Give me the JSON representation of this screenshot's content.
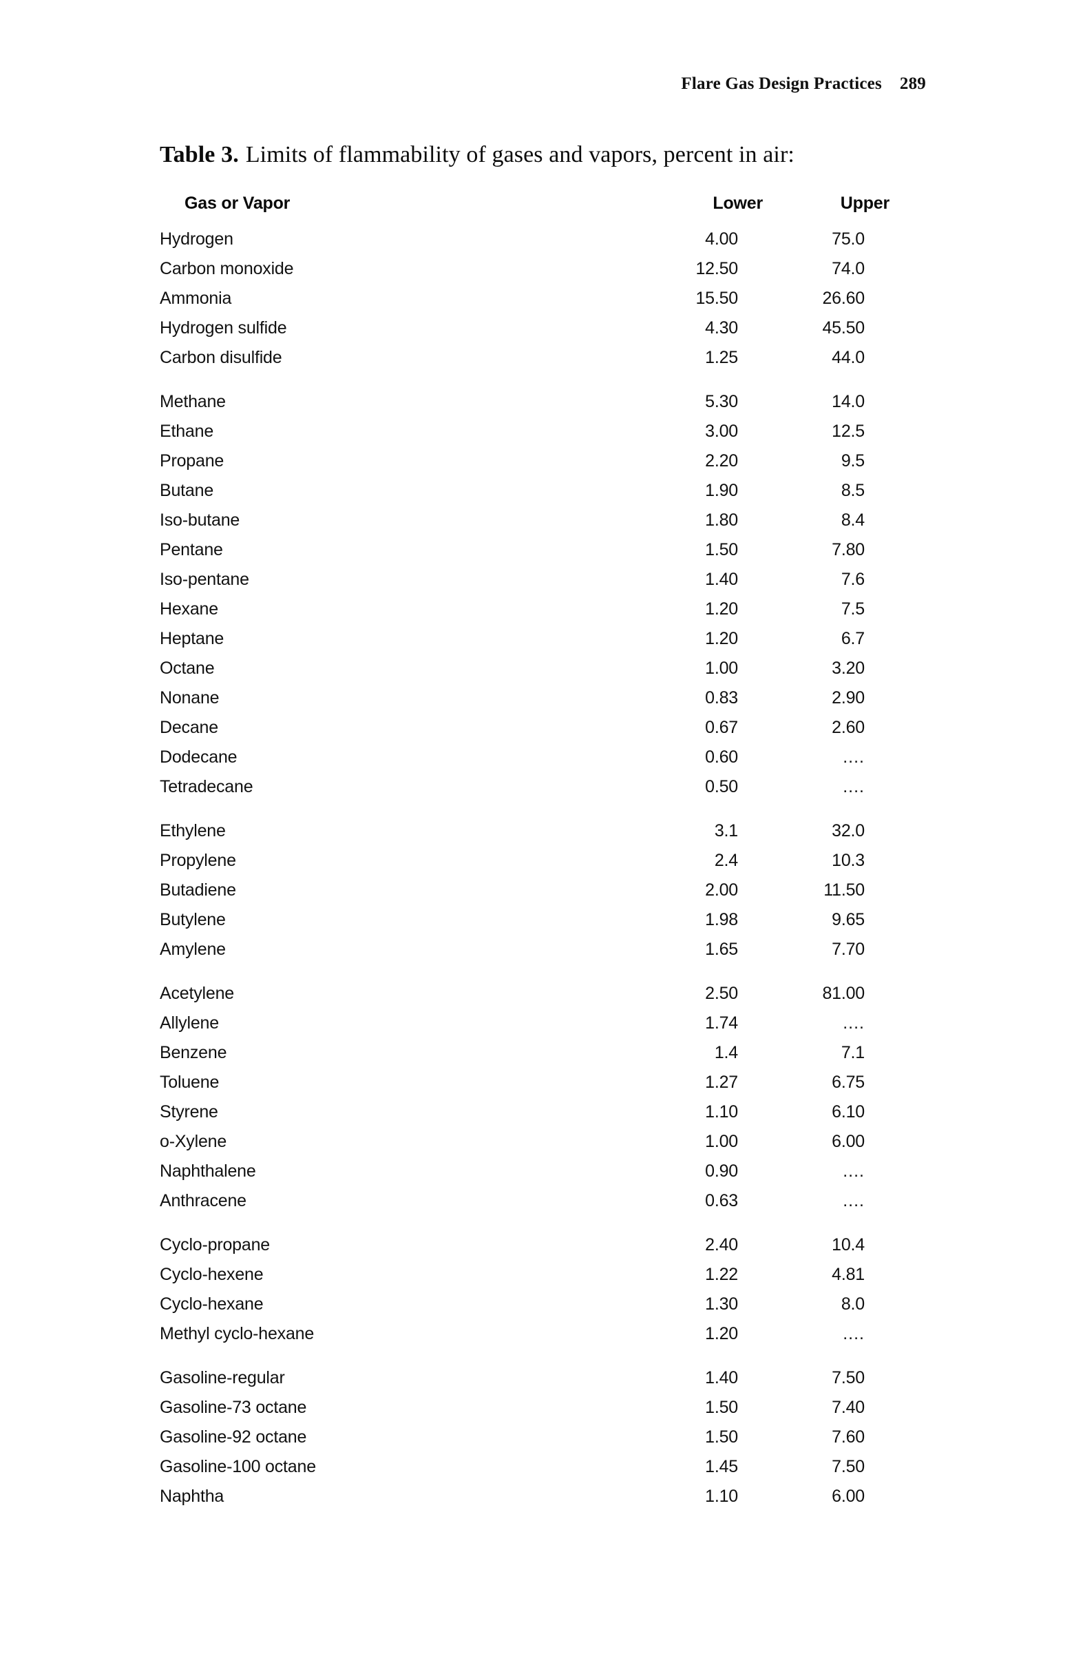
{
  "running_head": {
    "title": "Flare Gas Design Practices",
    "page_number": "289"
  },
  "caption": {
    "label": "Table 3.",
    "text": "Limits of flammability of gases and vapors, percent in air:"
  },
  "table": {
    "columns": {
      "name": "Gas or Vapor",
      "lower": "Lower",
      "upper": "Upper"
    },
    "groups": [
      {
        "rows": [
          {
            "name": "Hydrogen",
            "lower": "4.00",
            "upper": "75.0"
          },
          {
            "name": "Carbon monoxide",
            "lower": "12.50",
            "upper": "74.0"
          },
          {
            "name": "Ammonia",
            "lower": "15.50",
            "upper": "26.60"
          },
          {
            "name": "Hydrogen sulfide",
            "lower": "4.30",
            "upper": "45.50"
          },
          {
            "name": "Carbon disulfide",
            "lower": "1.25",
            "upper": "44.0"
          }
        ]
      },
      {
        "rows": [
          {
            "name": "Methane",
            "lower": "5.30",
            "upper": "14.0"
          },
          {
            "name": "Ethane",
            "lower": "3.00",
            "upper": "12.5"
          },
          {
            "name": "Propane",
            "lower": "2.20",
            "upper": "9.5"
          },
          {
            "name": "Butane",
            "lower": "1.90",
            "upper": "8.5"
          },
          {
            "name": "Iso-butane",
            "lower": "1.80",
            "upper": "8.4"
          },
          {
            "name": "Pentane",
            "lower": "1.50",
            "upper": "7.80"
          },
          {
            "name": "Iso-pentane",
            "lower": "1.40",
            "upper": "7.6"
          },
          {
            "name": "Hexane",
            "lower": "1.20",
            "upper": "7.5"
          },
          {
            "name": "Heptane",
            "lower": "1.20",
            "upper": "6.7"
          },
          {
            "name": "Octane",
            "lower": "1.00",
            "upper": "3.20"
          },
          {
            "name": "Nonane",
            "lower": "0.83",
            "upper": "2.90"
          },
          {
            "name": "Decane",
            "lower": "0.67",
            "upper": "2.60"
          },
          {
            "name": "Dodecane",
            "lower": "0.60",
            "upper": "...."
          },
          {
            "name": "Tetradecane",
            "lower": "0.50",
            "upper": "...."
          }
        ]
      },
      {
        "rows": [
          {
            "name": "Ethylene",
            "lower": "3.1",
            "upper": "32.0"
          },
          {
            "name": "Propylene",
            "lower": "2.4",
            "upper": "10.3"
          },
          {
            "name": "Butadiene",
            "lower": "2.00",
            "upper": "11.50"
          },
          {
            "name": "Butylene",
            "lower": "1.98",
            "upper": "9.65"
          },
          {
            "name": "Amylene",
            "lower": "1.65",
            "upper": "7.70"
          }
        ]
      },
      {
        "rows": [
          {
            "name": "Acetylene",
            "lower": "2.50",
            "upper": "81.00"
          },
          {
            "name": "Allylene",
            "lower": "1.74",
            "upper": "...."
          },
          {
            "name": "Benzene",
            "lower": "1.4",
            "upper": "7.1"
          },
          {
            "name": "Toluene",
            "lower": "1.27",
            "upper": "6.75"
          },
          {
            "name": "Styrene",
            "lower": "1.10",
            "upper": "6.10"
          },
          {
            "name": "o-Xylene",
            "lower": "1.00",
            "upper": "6.00"
          },
          {
            "name": "Naphthalene",
            "lower": "0.90",
            "upper": "...."
          },
          {
            "name": "Anthracene",
            "lower": "0.63",
            "upper": "...."
          }
        ]
      },
      {
        "rows": [
          {
            "name": "Cyclo-propane",
            "lower": "2.40",
            "upper": "10.4"
          },
          {
            "name": "Cyclo-hexene",
            "lower": "1.22",
            "upper": "4.81"
          },
          {
            "name": "Cyclo-hexane",
            "lower": "1.30",
            "upper": "8.0"
          },
          {
            "name": "Methyl cyclo-hexane",
            "lower": "1.20",
            "upper": "...."
          }
        ]
      },
      {
        "rows": [
          {
            "name": "Gasoline-regular",
            "lower": "1.40",
            "upper": "7.50"
          },
          {
            "name": "Gasoline-73 octane",
            "lower": "1.50",
            "upper": "7.40"
          },
          {
            "name": "Gasoline-92 octane",
            "lower": "1.50",
            "upper": "7.60"
          },
          {
            "name": "Gasoline-100 octane",
            "lower": "1.45",
            "upper": "7.50"
          },
          {
            "name": "Naphtha",
            "lower": "1.10",
            "upper": "6.00"
          }
        ]
      }
    ]
  }
}
